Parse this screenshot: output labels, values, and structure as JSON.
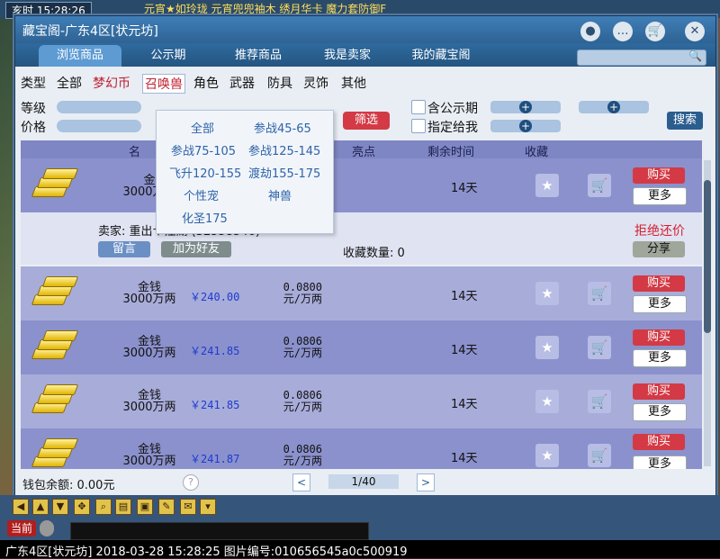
{
  "game": {
    "clock_label": "亥时",
    "clock_time": "15:28:26",
    "ticker": "元宵★如玲珑  元宵兜兜袖木  绣月华卡  魔力套防御F"
  },
  "window": {
    "title": "藏宝阁-广东4区[状元坊]",
    "controls": [
      "●",
      "…",
      "🛒",
      "✕"
    ]
  },
  "tabs": [
    "浏览商品",
    "公示期",
    "推荐商品",
    "我是卖家",
    "我的藏宝阁"
  ],
  "categories": {
    "label": "类型",
    "items": [
      "全部",
      "梦幻币",
      "召唤兽",
      "角色",
      "武器",
      "防具",
      "灵饰",
      "其他"
    ]
  },
  "filters": {
    "level_label": "等级",
    "price_label": "价格",
    "public_label": "含公示期",
    "assign_label": "指定给我",
    "filter_button": "筛选",
    "search_button": "搜索"
  },
  "dropdown": {
    "items": [
      "全部",
      "参战45-65",
      "参战75-105",
      "参战125-145",
      "飞升120-155",
      "渡劫155-175",
      "个性宠",
      "神兽",
      "化圣175"
    ]
  },
  "table": {
    "headers": [
      "名",
      "亮点",
      "剩余时间",
      "收藏"
    ],
    "rows": [
      {
        "name": "金",
        "sub": "3000万两",
        "price": "",
        "unit_a": "",
        "unit_b": "",
        "days": "14天"
      },
      {
        "name": "金钱",
        "sub": "3000万两",
        "price": "￥240.00",
        "unit_a": "0.0800",
        "unit_b": "元/万两",
        "days": "14天"
      },
      {
        "name": "金钱",
        "sub": "3000万两",
        "price": "￥241.85",
        "unit_a": "0.0806",
        "unit_b": "元/万两",
        "days": "14天"
      },
      {
        "name": "金钱",
        "sub": "3000万两",
        "price": "￥241.85",
        "unit_a": "0.0806",
        "unit_b": "元/万两",
        "days": "14天"
      },
      {
        "name": "金钱",
        "sub": "3000万两",
        "price": "￥241.87",
        "unit_a": "0.0806",
        "unit_b": "元/万两",
        "days": "14天"
      }
    ],
    "buy_label": "购买",
    "more_label": "更多"
  },
  "seller": {
    "label": "卖家: 重出ヤ江湖 (32558546)",
    "message_button": "留言",
    "friend_button": "加为好友",
    "fav_count": "收藏数量: 0",
    "refuse": "拒绝还价",
    "share_button": "分享"
  },
  "footer": {
    "wallet": "钱包余额: 0.00元",
    "help": "?",
    "prev": "<",
    "page": "1/40",
    "next": ">"
  },
  "hud": {
    "channel": "当前",
    "status_text": "广东4区[状元坊] 2018-03-28 15:28:25 图片编号:010656545a0c500919"
  },
  "colors": {
    "accent": "#2c5f8e",
    "buy_red": "#d33a45",
    "row_odd": "#8b91cc",
    "row_even": "#a8acd9",
    "price_blue": "#1e3bd0",
    "refuse_red": "#d32030"
  }
}
